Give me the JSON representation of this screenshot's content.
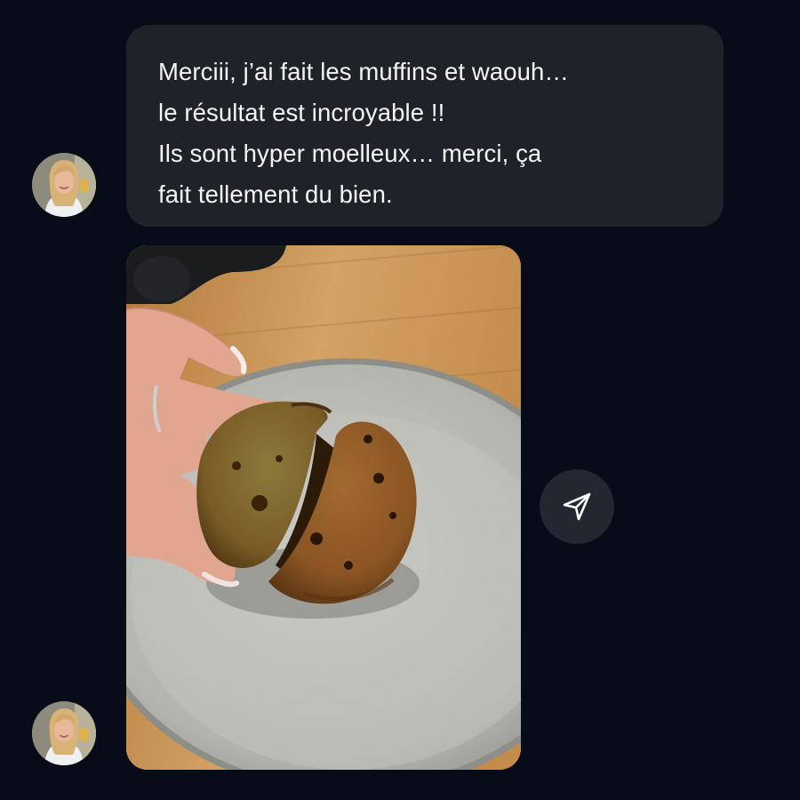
{
  "chat": {
    "message": {
      "lines": [
        "Merciii, j’ai fait les muffins et waouh…",
        "le résultat est incroyable !!",
        "Ils sont hyper moelleux… merci, ça",
        "fait tellement du bien."
      ]
    },
    "photo_icon": "muffin-photo",
    "share_icon": "send-icon",
    "colors": {
      "background": "#080c18",
      "bubble": "#1f2229",
      "text": "#f4f4f6",
      "share_button": "#23272f"
    }
  }
}
